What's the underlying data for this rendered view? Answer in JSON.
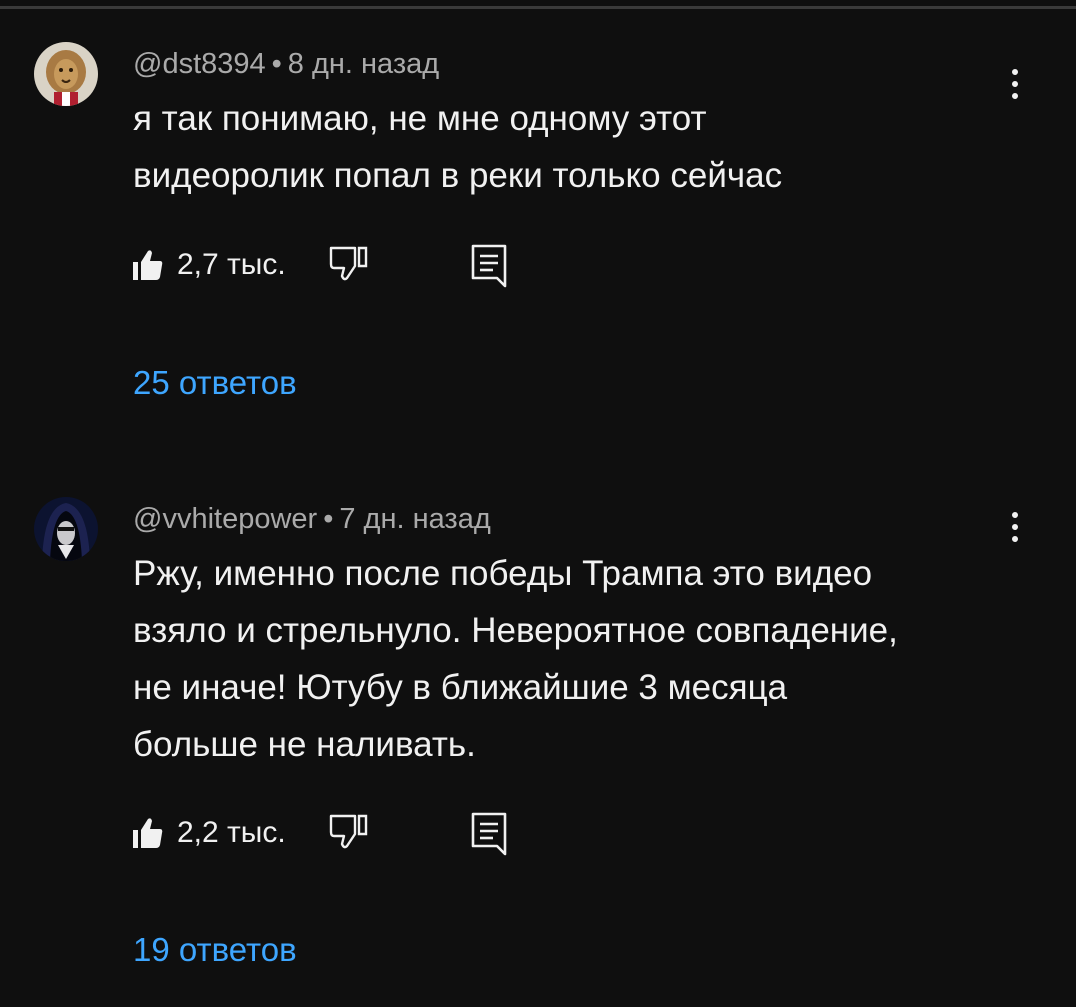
{
  "comments": [
    {
      "author": "@dst8394",
      "separator": "•",
      "time": "8 дн. назад",
      "text_lines": [
        "я так понимаю, не мне одному этот",
        "видеоролик попал в реки только сейчас"
      ],
      "likes": "2,7 тыс.",
      "replies": "25 ответов",
      "avatar_icon": "lion-avatar"
    },
    {
      "author": "@vvhitepower",
      "separator": "•",
      "time": "7 дн. назад",
      "text_lines": [
        "Ржу, именно после победы Трампа это видео",
        "взяло и стрельнуло. Невероятное совпадение,",
        "не иначе! Ютубу в ближайшие 3 месяца",
        "больше не наливать."
      ],
      "likes": "2,2 тыс.",
      "replies": "19 ответов",
      "avatar_icon": "hooded-figure-avatar"
    }
  ],
  "icons": {
    "like": "thumbs-up-icon",
    "dislike": "thumbs-down-icon",
    "reply": "reply-icon",
    "more": "more-vertical-icon"
  },
  "colors": {
    "background": "#0f0f0f",
    "text": "#f1f1f1",
    "meta": "#aaaaaa",
    "link": "#3ea6ff"
  }
}
